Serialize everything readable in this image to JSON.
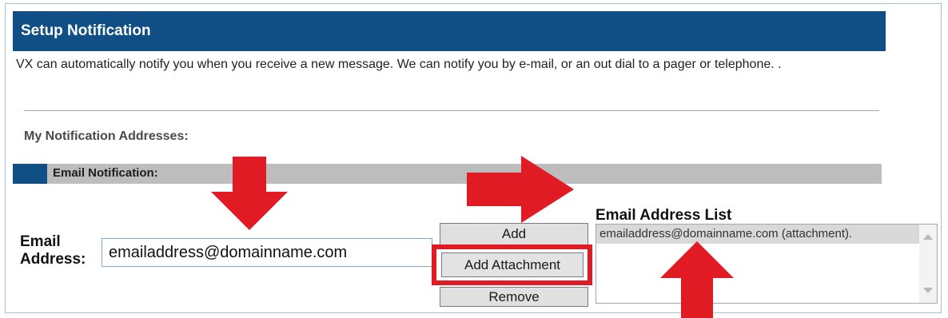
{
  "header": {
    "title": "Setup Notification"
  },
  "description": "VX can automatically notify you when you receive a new message. We can notify you by e-mail, or an out dial to a pager or telephone. .",
  "section": {
    "title": "My Notification Addresses:"
  },
  "subsection": {
    "title": "Email Notification:"
  },
  "email_field": {
    "label": "Email Address:",
    "value": "emailaddress@domainname.com"
  },
  "buttons": {
    "add": "Add",
    "add_attachment": "Add Attachment",
    "remove": "Remove"
  },
  "email_list": {
    "title": "Email Address List",
    "items": [
      "emailaddress@domainname.com (attachment)."
    ]
  },
  "icons": {
    "scroll_up": "scroll-up-arrow-icon",
    "scroll_down": "scroll-down-arrow-icon",
    "annotation_arrows": "red-arrow-icon"
  },
  "colors": {
    "header_bg": "#0f4f85",
    "subbar_bg": "#bdbdbd",
    "annotation_red": "#e01b24"
  }
}
